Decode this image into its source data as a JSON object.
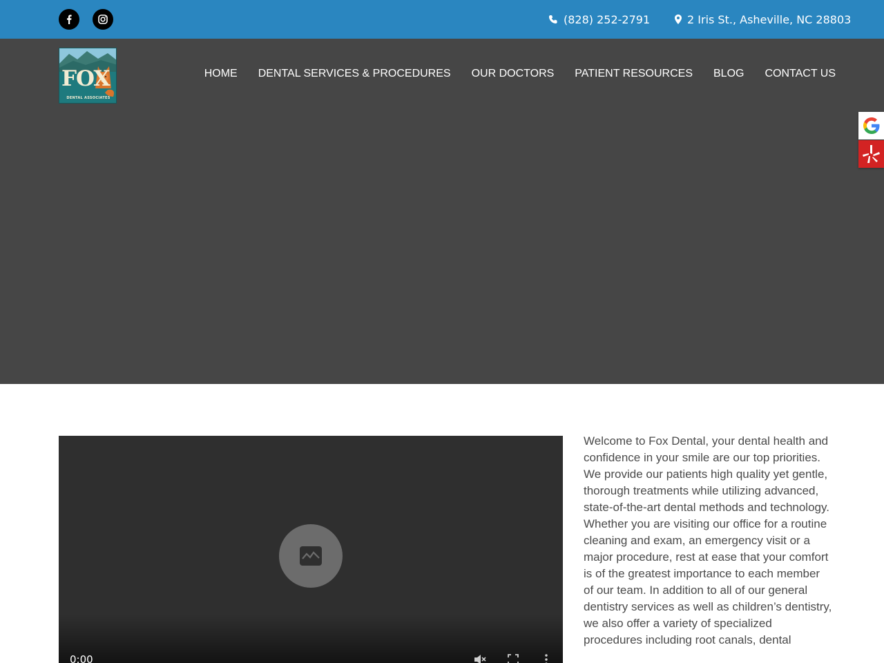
{
  "topbar": {
    "social": [
      {
        "name": "facebook-icon"
      },
      {
        "name": "instagram-icon"
      }
    ],
    "phone": "(828) 252-2791",
    "address": "2 Iris St., Asheville, NC 28803",
    "background": "#2a86c0"
  },
  "logo": {
    "word": "FOX",
    "subtitle": "DENTAL ASSOCIATES"
  },
  "nav": {
    "items": [
      {
        "label": "HOME"
      },
      {
        "label": "DENTAL SERVICES & PROCEDURES"
      },
      {
        "label": "OUR DOCTORS"
      },
      {
        "label": "PATIENT RESOURCES"
      },
      {
        "label": "BLOG"
      },
      {
        "label": "CONTACT US"
      }
    ]
  },
  "review_tabs": [
    {
      "name": "google-icon"
    },
    {
      "name": "yelp-icon",
      "color": "#d32323"
    }
  ],
  "video": {
    "time": "0:00",
    "controls": [
      "mute-icon",
      "fullscreen-icon",
      "more-options-icon"
    ]
  },
  "intro": {
    "text": "Welcome to Fox Dental, your dental health and confidence in your smile are our top priorities. We provide our patients high quality yet gentle, thorough treatments while utilizing advanced, state-of-the-art dental methods and technology. Whether you are visiting our office for a routine cleaning and exam, an emergency visit or a major procedure, rest at ease that your comfort is of the greatest importance to each member of our team. In addition to all of our general dentistry services as well as children’s dentistry, we also offer a variety of specialized procedures including root canals, dental"
  }
}
